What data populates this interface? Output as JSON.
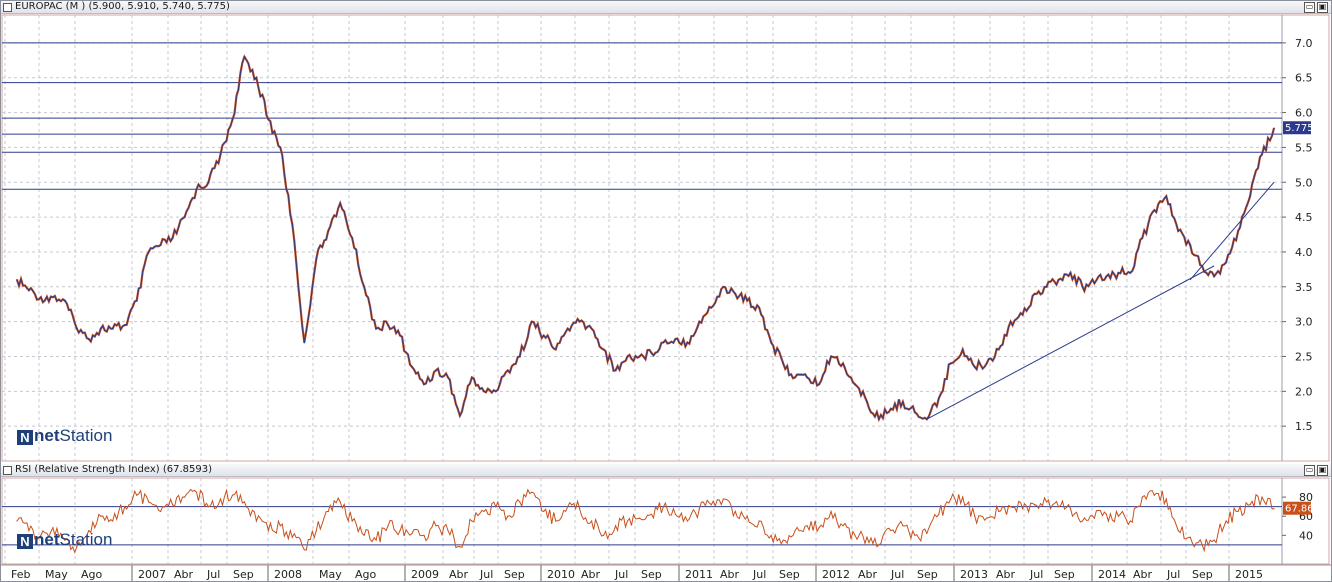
{
  "panels": {
    "price_title": "EUROPAC (M ) (5.900, 5.910, 5.740, 5.775)",
    "rsi_title": "RSI (Relative Strength Index) (67.8593)",
    "min_label": "▭",
    "restore_label": "▣"
  },
  "logo": {
    "net": "net",
    "station": "Station"
  },
  "colors": {
    "background": "#ffffff",
    "grid": "#c5c8d0",
    "price_line": "#2b3a8c",
    "price_down": "#c8501a",
    "rsi_line": "#c8501a",
    "level_line": "#2b3a8c"
  },
  "chart_data": [
    {
      "type": "line",
      "series": [
        {
          "values": [
            [
              "2005-12",
              3.6
            ],
            [
              "2006-01",
              3.45
            ],
            [
              "2006-02",
              3.35
            ],
            [
              "2006-03",
              3.35
            ],
            [
              "2006-04",
              3.3
            ],
            [
              "2006-05",
              2.9
            ],
            [
              "2006-06",
              2.75
            ],
            [
              "2006-07",
              2.9
            ],
            [
              "2006-08",
              2.9
            ],
            [
              "2006-09",
              2.95
            ],
            [
              "2006-10",
              3.3
            ],
            [
              "2006-11",
              4.0
            ],
            [
              "2006-12",
              4.1
            ],
            [
              "2007-01",
              4.2
            ],
            [
              "2007-02",
              4.5
            ],
            [
              "2007-03",
              4.9
            ],
            [
              "2007-04",
              5.0
            ],
            [
              "2007-05",
              5.4
            ],
            [
              "2007-06",
              5.9
            ],
            [
              "2007-07",
              6.8
            ],
            [
              "2007-08",
              6.5
            ],
            [
              "2007-09",
              5.9
            ],
            [
              "2007-10",
              5.5
            ],
            [
              "2007-11",
              4.4
            ],
            [
              "2007-12",
              2.7
            ],
            [
              "2008-01",
              3.9
            ],
            [
              "2008-02",
              4.3
            ],
            [
              "2008-03",
              4.7
            ],
            [
              "2008-04",
              4.2
            ],
            [
              "2008-05",
              3.5
            ],
            [
              "2008-06",
              2.9
            ],
            [
              "2008-07",
              2.95
            ],
            [
              "2008-08",
              2.8
            ],
            [
              "2008-09",
              2.35
            ],
            [
              "2008-10",
              2.1
            ],
            [
              "2008-11",
              2.3
            ],
            [
              "2008-12",
              2.2
            ],
            [
              "2009-01",
              1.65
            ],
            [
              "2009-02",
              2.2
            ],
            [
              "2009-03",
              2.0
            ],
            [
              "2009-04",
              2.0
            ],
            [
              "2009-05",
              2.3
            ],
            [
              "2009-06",
              2.5
            ],
            [
              "2009-07",
              3.0
            ],
            [
              "2009-08",
              2.8
            ],
            [
              "2009-09",
              2.6
            ],
            [
              "2009-10",
              2.9
            ],
            [
              "2009-11",
              3.0
            ],
            [
              "2009-12",
              2.9
            ],
            [
              "2010-01",
              2.6
            ],
            [
              "2010-02",
              2.3
            ],
            [
              "2010-03",
              2.5
            ],
            [
              "2010-04",
              2.5
            ],
            [
              "2010-05",
              2.55
            ],
            [
              "2010-06",
              2.7
            ],
            [
              "2010-07",
              2.75
            ],
            [
              "2010-08",
              2.7
            ],
            [
              "2010-09",
              3.0
            ],
            [
              "2010-10",
              3.2
            ],
            [
              "2010-11",
              3.5
            ],
            [
              "2010-12",
              3.4
            ],
            [
              "2011-01",
              3.3
            ],
            [
              "2011-02",
              3.2
            ],
            [
              "2011-03",
              2.7
            ],
            [
              "2011-04",
              2.4
            ],
            [
              "2011-05",
              2.2
            ],
            [
              "2011-06",
              2.2
            ],
            [
              "2011-07",
              2.1
            ],
            [
              "2011-08",
              2.5
            ],
            [
              "2011-09",
              2.4
            ],
            [
              "2011-10",
              2.1
            ],
            [
              "2011-11",
              1.85
            ],
            [
              "2011-12",
              1.6
            ],
            [
              "2012-01",
              1.75
            ],
            [
              "2012-02",
              1.85
            ],
            [
              "2012-03",
              1.7
            ],
            [
              "2012-04",
              1.6
            ],
            [
              "2012-05",
              1.9
            ],
            [
              "2012-06",
              2.4
            ],
            [
              "2012-07",
              2.6
            ],
            [
              "2012-08",
              2.35
            ],
            [
              "2012-09",
              2.4
            ],
            [
              "2012-10",
              2.6
            ],
            [
              "2012-11",
              3.0
            ],
            [
              "2012-12",
              3.1
            ],
            [
              "2013-01",
              3.4
            ],
            [
              "2013-02",
              3.5
            ],
            [
              "2013-03",
              3.6
            ],
            [
              "2013-04",
              3.7
            ],
            [
              "2013-05",
              3.5
            ],
            [
              "2013-06",
              3.55
            ],
            [
              "2013-07",
              3.65
            ],
            [
              "2013-08",
              3.7
            ],
            [
              "2013-09",
              3.7
            ],
            [
              "2013-10",
              4.2
            ],
            [
              "2013-11",
              4.6
            ],
            [
              "2013-12",
              4.8
            ],
            [
              "2014-01",
              4.3
            ],
            [
              "2014-02",
              4.1
            ],
            [
              "2014-03",
              3.8
            ],
            [
              "2014-04",
              3.65
            ],
            [
              "2014-05",
              3.85
            ],
            [
              "2014-06",
              4.3
            ],
            [
              "2014-07",
              4.8
            ],
            [
              "2014-08",
              5.4
            ],
            [
              "2014-09",
              5.775
            ]
          ]
        }
      ],
      "ylim": [
        1.0,
        7.4
      ],
      "yticks": [
        "7.0",
        "6.5",
        "6.0",
        "5.5",
        "5.0",
        "4.5",
        "4.0",
        "3.5",
        "3.0",
        "2.5",
        "2.0",
        "1.5"
      ],
      "price_label": "5.775",
      "horizontal_levels": [
        7.0,
        6.43,
        5.92,
        5.69,
        5.43,
        4.9
      ],
      "trendlines": [
        [
          [
            "2012-04",
            1.6
          ],
          [
            "2014-04",
            3.8
          ]
        ],
        [
          [
            "2014-02",
            3.6
          ],
          [
            "2014-09",
            5.0
          ]
        ]
      ]
    },
    {
      "type": "line",
      "series": [
        {
          "values": [
            [
              "2005-12",
              55
            ],
            [
              "2006-01",
              45
            ],
            [
              "2006-02",
              40
            ],
            [
              "2006-03",
              48
            ],
            [
              "2006-04",
              35
            ],
            [
              "2006-05",
              28
            ],
            [
              "2006-06",
              45
            ],
            [
              "2006-07",
              60
            ],
            [
              "2006-08",
              55
            ],
            [
              "2006-09",
              70
            ],
            [
              "2006-10",
              82
            ],
            [
              "2006-11",
              75
            ],
            [
              "2006-12",
              65
            ],
            [
              "2007-01",
              72
            ],
            [
              "2007-02",
              80
            ],
            [
              "2007-03",
              85
            ],
            [
              "2007-04",
              70
            ],
            [
              "2007-05",
              78
            ],
            [
              "2007-06",
              82
            ],
            [
              "2007-07",
              75
            ],
            [
              "2007-08",
              55
            ],
            [
              "2007-09",
              45
            ],
            [
              "2007-10",
              50
            ],
            [
              "2007-11",
              38
            ],
            [
              "2007-12",
              25
            ],
            [
              "2008-01",
              45
            ],
            [
              "2008-02",
              65
            ],
            [
              "2008-03",
              75
            ],
            [
              "2008-04",
              55
            ],
            [
              "2008-05",
              40
            ],
            [
              "2008-06",
              35
            ],
            [
              "2008-07",
              50
            ],
            [
              "2008-08",
              45
            ],
            [
              "2008-09",
              42
            ],
            [
              "2008-10",
              40
            ],
            [
              "2008-11",
              50
            ],
            [
              "2008-12",
              45
            ],
            [
              "2009-01",
              28
            ],
            [
              "2009-02",
              55
            ],
            [
              "2009-03",
              65
            ],
            [
              "2009-04",
              70
            ],
            [
              "2009-05",
              60
            ],
            [
              "2009-06",
              75
            ],
            [
              "2009-07",
              85
            ],
            [
              "2009-08",
              65
            ],
            [
              "2009-09",
              55
            ],
            [
              "2009-10",
              70
            ],
            [
              "2009-11",
              68
            ],
            [
              "2009-12",
              55
            ],
            [
              "2010-01",
              40
            ],
            [
              "2010-02",
              50
            ],
            [
              "2010-03",
              55
            ],
            [
              "2010-04",
              58
            ],
            [
              "2010-05",
              62
            ],
            [
              "2010-06",
              70
            ],
            [
              "2010-07",
              62
            ],
            [
              "2010-08",
              55
            ],
            [
              "2010-09",
              68
            ],
            [
              "2010-10",
              72
            ],
            [
              "2010-11",
              78
            ],
            [
              "2010-12",
              65
            ],
            [
              "2011-01",
              60
            ],
            [
              "2011-02",
              55
            ],
            [
              "2011-03",
              40
            ],
            [
              "2011-04",
              35
            ],
            [
              "2011-05",
              45
            ],
            [
              "2011-06",
              50
            ],
            [
              "2011-07",
              48
            ],
            [
              "2011-08",
              65
            ],
            [
              "2011-09",
              50
            ],
            [
              "2011-10",
              40
            ],
            [
              "2011-11",
              38
            ],
            [
              "2011-12",
              30
            ],
            [
              "2012-01",
              45
            ],
            [
              "2012-02",
              50
            ],
            [
              "2012-03",
              40
            ],
            [
              "2012-04",
              42
            ],
            [
              "2012-05",
              62
            ],
            [
              "2012-06",
              78
            ],
            [
              "2012-07",
              80
            ],
            [
              "2012-08",
              60
            ],
            [
              "2012-09",
              58
            ],
            [
              "2012-10",
              65
            ],
            [
              "2012-11",
              70
            ],
            [
              "2012-12",
              68
            ],
            [
              "2013-01",
              72
            ],
            [
              "2013-02",
              75
            ],
            [
              "2013-03",
              70
            ],
            [
              "2013-04",
              68
            ],
            [
              "2013-05",
              55
            ],
            [
              "2013-06",
              58
            ],
            [
              "2013-07",
              62
            ],
            [
              "2013-08",
              60
            ],
            [
              "2013-09",
              55
            ],
            [
              "2013-10",
              80
            ],
            [
              "2013-11",
              82
            ],
            [
              "2013-12",
              78
            ],
            [
              "2014-01",
              45
            ],
            [
              "2014-02",
              38
            ],
            [
              "2014-03",
              30
            ],
            [
              "2014-04",
              35
            ],
            [
              "2014-05",
              55
            ],
            [
              "2014-06",
              65
            ],
            [
              "2014-07",
              72
            ],
            [
              "2014-08",
              80
            ],
            [
              "2014-09",
              67.86
            ]
          ]
        }
      ],
      "ylim": [
        10,
        100
      ],
      "yticks": [
        "80",
        "60",
        "40"
      ],
      "rsi_label": "67.86",
      "levels": [
        70,
        30
      ],
      "xticks": [
        "Feb",
        "May",
        "Ago",
        "2007",
        "Abr",
        "Jul",
        "Sep",
        "2008",
        "May",
        "Ago",
        "2009",
        "Abr",
        "Jul",
        "Sep",
        "2010",
        "Abr",
        "Jul",
        "Sep",
        "2011",
        "Abr",
        "Jul",
        "Sep",
        "2012",
        "Abr",
        "Jul",
        "Sep",
        "2013",
        "Abr",
        "Jul",
        "Sep",
        "2014",
        "Abr",
        "Jul",
        "Sep",
        "2015"
      ]
    }
  ]
}
